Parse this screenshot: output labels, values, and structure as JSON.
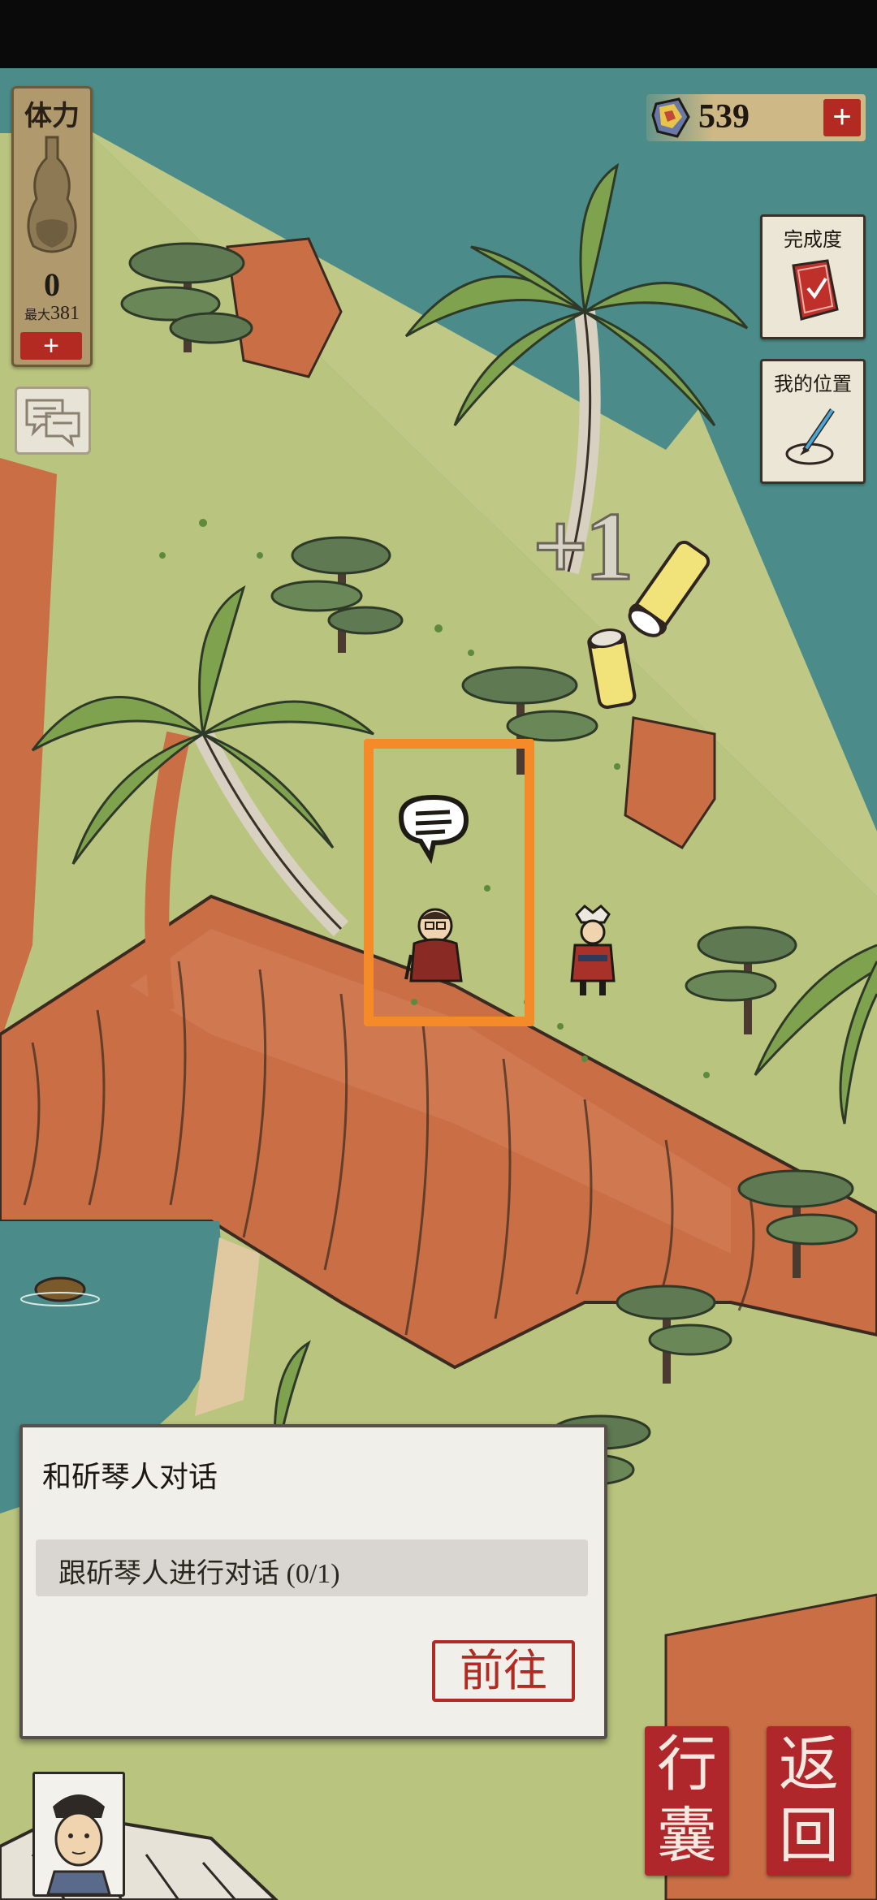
{
  "hud": {
    "stamina": {
      "label": "体力",
      "value": "0",
      "max_label": "最大",
      "max_value": "381",
      "plus": "+"
    },
    "currency": {
      "value": "539",
      "plus": "+"
    },
    "completion_label": "完成度",
    "my_location_label": "我的位置"
  },
  "map": {
    "reward_text": "+1"
  },
  "quest": {
    "title": "和斫琴人对话",
    "task": "跟斫琴人进行对话 (0/1)",
    "go_button": "前往"
  },
  "buttons": {
    "bag": [
      "行",
      "囊"
    ],
    "back": [
      "返",
      "回"
    ]
  },
  "icons": {
    "stamina": "gourd-icon",
    "currency": "gem-icon",
    "completion": "red-book-icon",
    "location": "brush-icon",
    "chat": "chat-bubbles-icon",
    "npc_speech": "speech-bubble-icon"
  },
  "colors": {
    "sea": "#4b8c8a",
    "grass": "#b9c47e",
    "cliff": "#c96e45",
    "highlight": "#f58a28",
    "accent_red": "#b32a22"
  }
}
